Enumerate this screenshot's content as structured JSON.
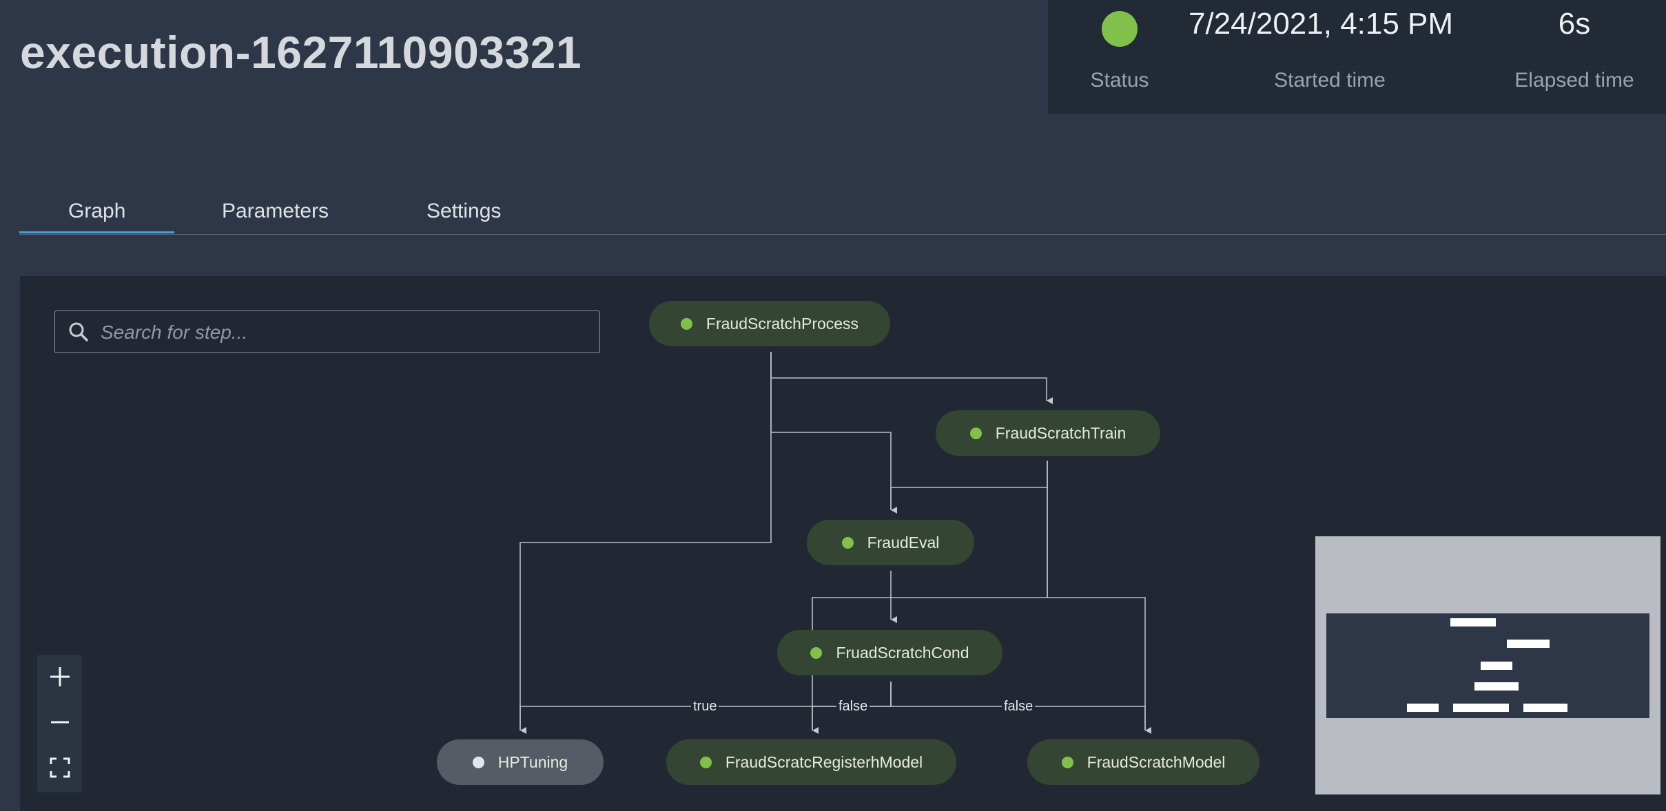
{
  "page": {
    "title": "execution-1627110903321"
  },
  "status_panel": {
    "status_label": "Status",
    "started_time": "7/24/2021, 4:15 PM",
    "started_label": "Started time",
    "elapsed_time": "6s",
    "elapsed_label": "Elapsed time",
    "status_color": "#81c14b"
  },
  "tabs": [
    {
      "label": "Graph",
      "active": true
    },
    {
      "label": "Parameters",
      "active": false
    },
    {
      "label": "Settings",
      "active": false
    }
  ],
  "graph": {
    "search_placeholder": "Search for step...",
    "nodes": [
      {
        "label": "FraudScratchProcess",
        "status": "succeeded"
      },
      {
        "label": "FraudScratchTrain",
        "status": "succeeded"
      },
      {
        "label": "FraudEval",
        "status": "succeeded"
      },
      {
        "label": "FruadScratchCond",
        "status": "succeeded"
      },
      {
        "label": "HPTuning",
        "status": "not-started"
      },
      {
        "label": "FraudScratcRegisterhModel",
        "status": "succeeded"
      },
      {
        "label": "FraudScratchModel",
        "status": "succeeded"
      }
    ],
    "edge_labels": {
      "true_label": "true",
      "false_label_1": "false",
      "false_label_2": "false"
    },
    "zoom_controls": {
      "zoom_in_icon": "plus-icon",
      "zoom_out_icon": "minus-icon",
      "fit_icon": "fit-screen-icon"
    },
    "colors": {
      "success": "#81c14b",
      "node_bg": "#344533",
      "pending_bg": "#555c66",
      "accent": "#44a3d8"
    }
  }
}
